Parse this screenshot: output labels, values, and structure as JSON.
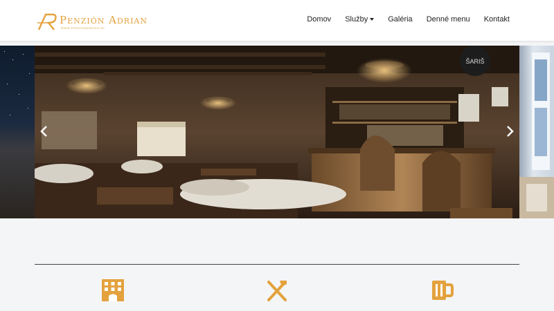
{
  "brand": {
    "title": "Penzión Adrian",
    "subtitle": "WWW.PENZIONADRIAN.SK",
    "color": "#e3a23d"
  },
  "nav": {
    "items": [
      {
        "label": "Domov"
      },
      {
        "label": "Služby",
        "dropdown": true
      },
      {
        "label": "Galéria"
      },
      {
        "label": "Denné menu"
      },
      {
        "label": "Kontakt"
      }
    ]
  },
  "carousel": {
    "image_sign": "ŠARIŠ",
    "prev_icon": "chevron-left-icon",
    "next_icon": "chevron-right-icon"
  },
  "features": [
    {
      "icon": "hotel-icon"
    },
    {
      "icon": "cutlery-icon"
    },
    {
      "icon": "beer-mug-icon"
    }
  ],
  "colors": {
    "accent": "#e3a23d",
    "header_bg": "#ffffff",
    "content_bg": "#f4f5f7"
  }
}
